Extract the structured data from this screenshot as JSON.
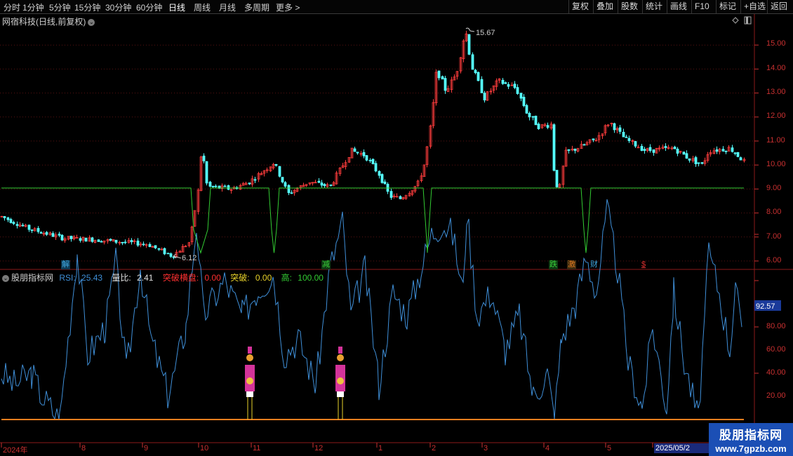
{
  "toolbar": {
    "timeframes": [
      "分时",
      "1分钟",
      "5分钟",
      "15分钟",
      "30分钟",
      "60分钟",
      "日线",
      "周线",
      "月线",
      "多周期",
      "更多 >"
    ],
    "active": "日线",
    "right_buttons": [
      "复权",
      "叠加",
      "股数",
      "统计",
      "画线",
      "F10",
      "标记",
      "+自选",
      "返回"
    ]
  },
  "stock": {
    "title": "网宿科技(日线,前复权)"
  },
  "price_axis": {
    "labels": [
      "15.00",
      "14.00",
      "13.00",
      "12.00",
      "11.00",
      "10.00",
      "9.00",
      "8.00",
      "7.00",
      "6.00"
    ]
  },
  "markers": {
    "high": "15.67",
    "low": "6.12"
  },
  "events": [
    {
      "label": "解",
      "color": "#3fa7e0"
    },
    {
      "label": "减",
      "color": "#3ad03a"
    },
    {
      "label": "跌",
      "color": "#3ad03a"
    },
    {
      "label": "激",
      "color": "#e07a20"
    },
    {
      "label": "财",
      "color": "#3fa7e0"
    },
    {
      "label": "$",
      "color": "#e03030"
    }
  ],
  "indicator": {
    "name": "股朋指标网",
    "rsi_label": "RSI:",
    "rsi_value": "25.43",
    "vol_label": "量比:",
    "vol_value": "2.41",
    "break_label": "突破横盘:",
    "break_value": "0.00",
    "tupo_label": "突破:",
    "tupo_value": "0.00",
    "high_label": "高:",
    "high_value": "100.00",
    "axis_labels": [
      "80.00",
      "60.00",
      "40.00",
      "20.00"
    ],
    "current_value": "92.57"
  },
  "date_axis": {
    "labels": [
      "2024年",
      "8",
      "9",
      "10",
      "11",
      "12",
      "1",
      "2",
      "3",
      "4",
      "5",
      "2025/05/2"
    ]
  },
  "watermark": {
    "line1": "股朋指标网",
    "line2": "www.7gpzb.com"
  },
  "colors": {
    "up": "#ff3c3c",
    "down": "#54ffff",
    "rsi": "#3f8fd8",
    "green_line": "#33cc33",
    "orange_line": "#ff7f1f",
    "axis_red": "#c83030"
  }
}
